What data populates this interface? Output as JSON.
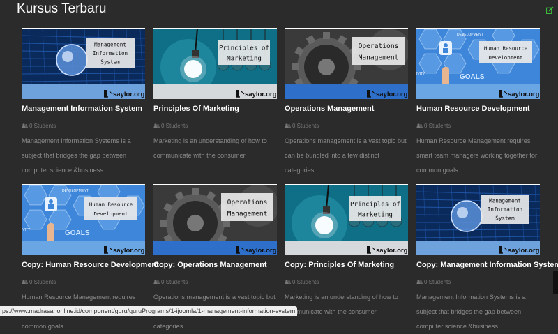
{
  "header": {
    "title": "Kursus Terbaru"
  },
  "colors": {
    "accent": "#3dbb3d",
    "card_blue": "#2b6fcf"
  },
  "courses": [
    {
      "title": "Management Information System",
      "students": "0 Students",
      "desc": "Management Information Systems is a subject that bridges the gap between computer science &business",
      "overlay": [
        "Management",
        "Information",
        "System"
      ],
      "brand": "saylor.org",
      "theme": "network"
    },
    {
      "title": "Principles Of Marketing",
      "students": "0 Students",
      "desc": "Marketing is an understanding of how to communicate with the consumer.",
      "overlay": [
        "Principles of",
        "Marketing"
      ],
      "brand": "saylor.org",
      "theme": "bulbs"
    },
    {
      "title": "Operations Management",
      "students": "0 Students",
      "desc": "Operations management is a vast topic but can be bundled into a few distinct categories",
      "overlay": [
        "Operations",
        "Management"
      ],
      "brand": "saylor.org",
      "theme": "gears"
    },
    {
      "title": "Human Resource Development",
      "students": "0 Students",
      "desc": "Human Resource Management requires smart team managers working together for common goals.",
      "overlay": [
        "Human Resource",
        "Development"
      ],
      "brand": "saylor.org",
      "theme": "hr"
    },
    {
      "title": "Copy: Human Resource Development",
      "students": "0 Students",
      "desc": "Human Resource Management requires smart team managers working together for common goals.",
      "overlay": [
        "Human Resource",
        "Development"
      ],
      "brand": "saylor.org",
      "theme": "hr"
    },
    {
      "title": "Copy: Operations Management",
      "students": "0 Students",
      "desc": "Operations management is a vast topic but can be bundled into a few distinct categories",
      "overlay": [
        "Operations",
        "Management"
      ],
      "brand": "saylor.org",
      "theme": "gears"
    },
    {
      "title": "Copy: Principles Of Marketing",
      "students": "0 Students",
      "desc": "Marketing is an understanding of how to communicate with the consumer.",
      "overlay": [
        "Principles of",
        "Marketing"
      ],
      "brand": "saylor.org",
      "theme": "bulbs"
    },
    {
      "title": "Copy: Management Information System",
      "students": "0 Students",
      "desc": "Management Information Systems is a subject that bridges the gap between computer science &business",
      "overlay": [
        "Management",
        "Information",
        "System"
      ],
      "brand": "saylor.org",
      "theme": "network"
    }
  ],
  "hr_tags": {
    "development": "DEVELOPMENT",
    "goals": "GOALS",
    "activity": "IVITY"
  },
  "status_bar": {
    "url": "ps://www.madrasahonline.id/component/guru/guruPrograms/1-ijoomla/1-management-information-system"
  },
  "icons": {
    "edit": "edit-icon",
    "students": "users-icon"
  }
}
